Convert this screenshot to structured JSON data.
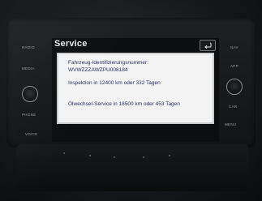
{
  "screen": {
    "title": "Service"
  },
  "message": {
    "vin_label": "Fahrzeug-Identifizierungsnummer:",
    "vin_value": "WVWZZZAWZPU008184",
    "inspection": "Inspektion in 12400 km oder 332 Tagen",
    "oil_service": "Ölwechsel-Service in 18500 km oder 453 Tagen"
  },
  "buttons": {
    "radio": "RADIO",
    "media": "MEDIA",
    "phone": "PHONE",
    "voice": "VOICE",
    "nav": "NAV",
    "app": "APP",
    "car": "CAR",
    "menu": "MENU"
  },
  "icons": {
    "back": "back-arrow-icon",
    "volume": "volume-knob",
    "tune": "tune-knob"
  }
}
